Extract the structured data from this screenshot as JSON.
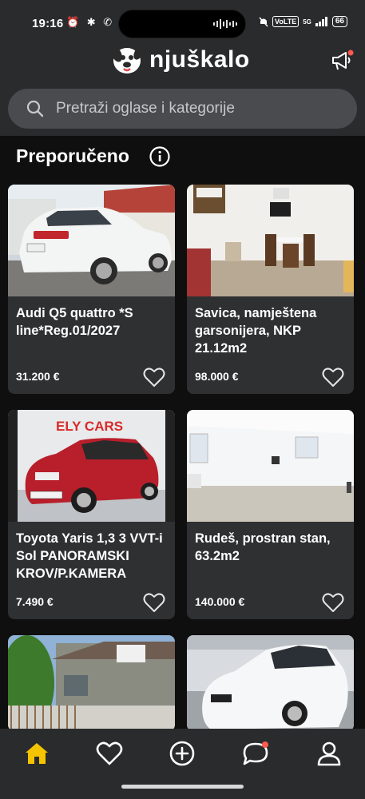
{
  "status_bar": {
    "time": "19:16",
    "left_icons": "⏰ ✱ ✆",
    "volte": "VoLTE",
    "network": "5G",
    "battery": "66"
  },
  "header": {
    "brand": "njuškalo",
    "search_placeholder": "Pretraži oglase i kategorije"
  },
  "main": {
    "section_title": "Preporučeno",
    "listings": [
      {
        "title": "Audi Q5 quattro *S line*Reg.01/2027",
        "price": "31.200 €",
        "image": "white-audi-suv"
      },
      {
        "title": "Savica, namještena garsonijera, NKP 21.12m2",
        "price": "98.000 €",
        "image": "furnished-studio-room"
      },
      {
        "title": "Toyota Yaris 1,3 3 VVT-i Sol PANORAMSKI KROV/P.KAMERA",
        "price": "7.490 €",
        "image": "red-toyota-yaris",
        "image_text": "ELY CARS"
      },
      {
        "title": "Rudeš, prostran stan, 63.2m2",
        "price": "140.000 €",
        "image": "empty-bright-room"
      },
      {
        "title": "",
        "price": "",
        "image": "house-with-garden"
      },
      {
        "title": "",
        "price": "",
        "image": "white-bmw-hatchback"
      }
    ]
  },
  "bottom_nav": {
    "items": [
      "home-icon",
      "heart-icon",
      "plus-circle-icon",
      "chat-icon",
      "profile-icon"
    ]
  },
  "colors": {
    "accent": "#f5c400",
    "notification": "#ff5a4e",
    "card_bg": "#2f3032",
    "bar_bg": "#2a2b2d",
    "page_bg": "#0f0f10"
  }
}
